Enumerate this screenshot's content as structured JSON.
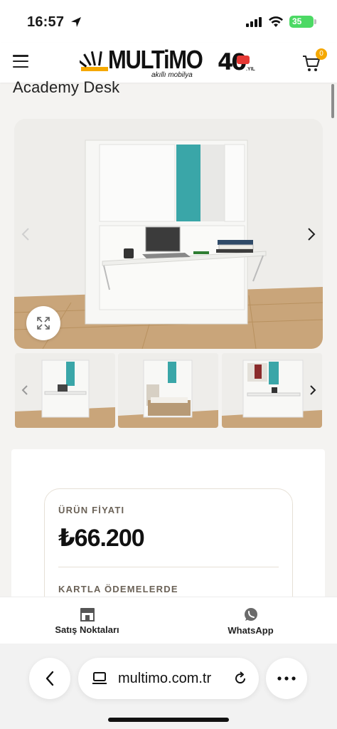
{
  "status": {
    "time": "16:57",
    "battery": "35"
  },
  "header": {
    "logo_text": "MULTiMO",
    "logo_sub": "akıllı mobilya",
    "anniversary": "40",
    "anniversary_suffix": ".YIL",
    "cart_count": "0"
  },
  "product": {
    "title": "Academy Desk"
  },
  "gallery": {
    "thumbnails": [
      "thumb-1",
      "thumb-2",
      "thumb-3"
    ]
  },
  "price": {
    "label": "ÜRÜN FİYATI",
    "value": "₺66.200",
    "card_label": "KARTLA ÖDEMELERDE"
  },
  "actions": {
    "stores": "Satış Noktaları",
    "whatsapp": "WhatsApp"
  },
  "browser": {
    "url": "multimo.com.tr"
  },
  "colors": {
    "accent_teal": "#3aa6a8",
    "brand_orange": "#f5a800"
  }
}
